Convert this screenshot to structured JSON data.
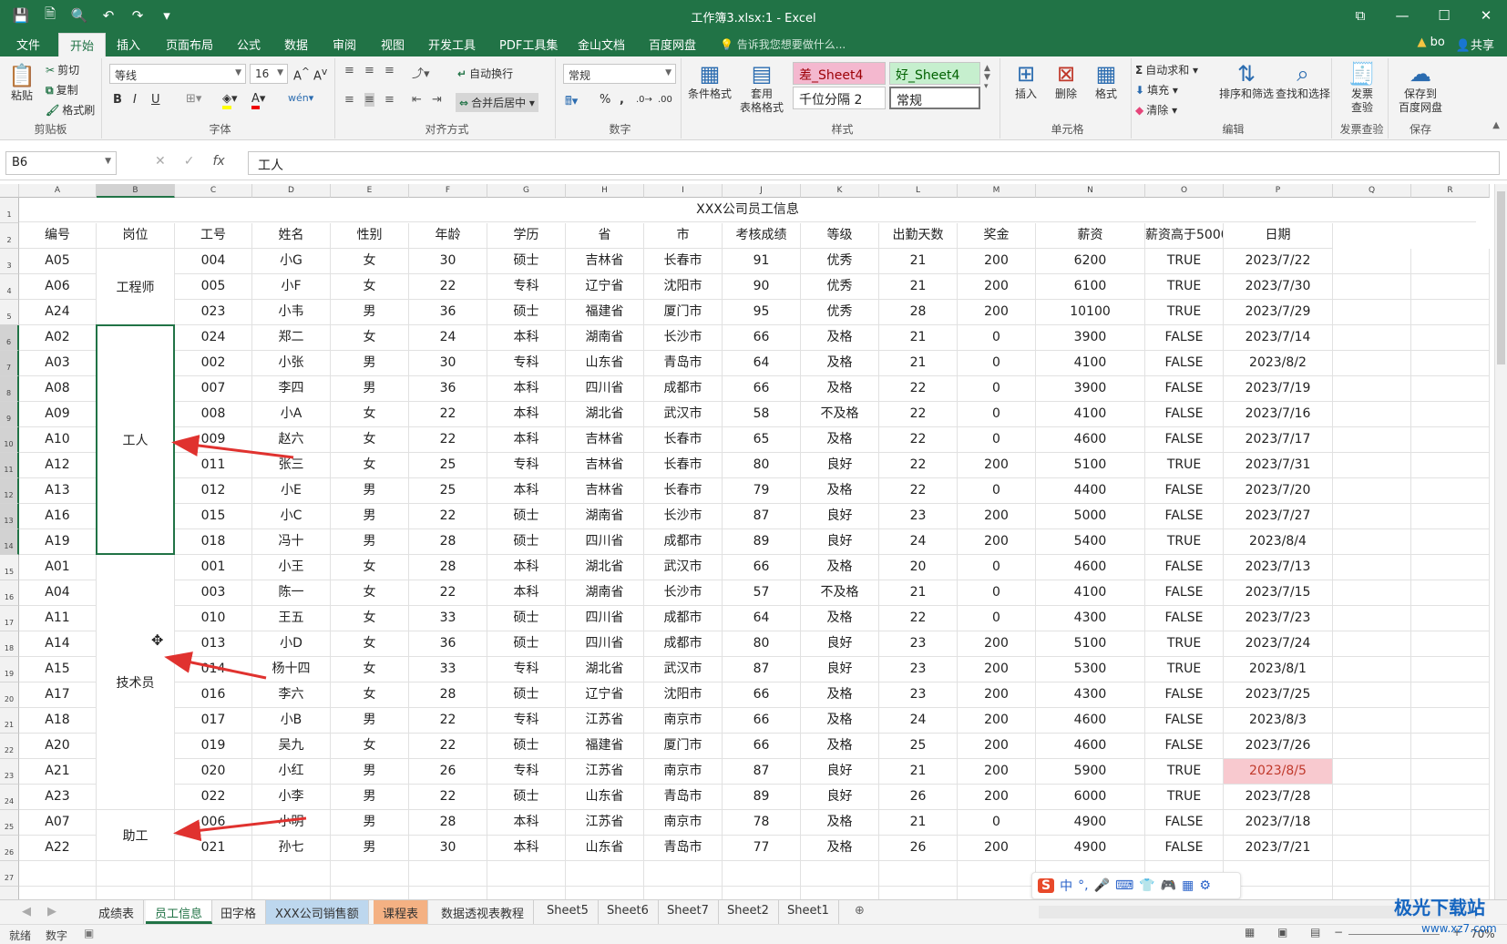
{
  "window": {
    "title": "工作簿3.xlsx:1  -  Excel",
    "ctrl_ribbon": "⧉",
    "ctrl_min": "—",
    "ctrl_max": "☐",
    "ctrl_close": "✕"
  },
  "qat": [
    {
      "name": "save-icon",
      "glyph": "💾"
    },
    {
      "name": "print-preview-icon",
      "glyph": "🗎"
    },
    {
      "name": "find-icon",
      "glyph": "🔍"
    },
    {
      "name": "undo-icon",
      "glyph": "↶"
    },
    {
      "name": "redo-icon",
      "glyph": "↷"
    },
    {
      "name": "customize-icon",
      "glyph": "▾"
    }
  ],
  "ribbon_tabs": [
    "文件",
    "开始",
    "插入",
    "页面布局",
    "公式",
    "数据",
    "审阅",
    "视图",
    "开发工具",
    "PDF工具集",
    "金山文档",
    "百度网盘"
  ],
  "tellme": "告诉我您想要做什么...",
  "account": {
    "warn": "bo",
    "share": "共享"
  },
  "ribbon": {
    "clipboard": {
      "label": "剪贴板",
      "paste": "粘贴",
      "cut": "剪切",
      "copy": "复制",
      "painter": "格式刷"
    },
    "font": {
      "label": "字体",
      "name": "等线",
      "size": "16",
      "bold": "B",
      "italic": "I",
      "underline": "U"
    },
    "align": {
      "label": "对齐方式",
      "wrap": "自动换行",
      "merge": "合并后居中"
    },
    "number": {
      "label": "数字",
      "format": "常规",
      "percent": "%",
      "comma": ","
    },
    "styles": {
      "label": "样式",
      "cond": "条件格式",
      "table": "套用\n表格格式",
      "bad": "差_Sheet4",
      "good": "好_Sheet4",
      "comma2": "千位分隔 2",
      "normal": "常规"
    },
    "cells": {
      "label": "单元格",
      "insert": "插入",
      "delete": "删除",
      "format": "格式"
    },
    "editing": {
      "label": "编辑",
      "autosum": "自动求和",
      "fill": "填充",
      "clear": "清除",
      "sort": "排序和筛选",
      "find": "查找和选择"
    },
    "invoice": {
      "label": "发票查验",
      "btn": "发票\n查验"
    },
    "save": {
      "label": "保存",
      "btn": "保存到\n百度网盘"
    }
  },
  "formula_bar": {
    "cell_ref": "B6",
    "content": "工人"
  },
  "columns": [
    "A",
    "B",
    "C",
    "D",
    "E",
    "F",
    "G",
    "H",
    "I",
    "J",
    "K",
    "L",
    "M",
    "N",
    "O",
    "P",
    "Q",
    "R"
  ],
  "sheet_title": "XXX公司员工信息",
  "headers": [
    "编号",
    "岗位",
    "工号",
    "姓名",
    "性别",
    "年龄",
    "学历",
    "省",
    "市",
    "考核成绩",
    "等级",
    "出勤天数",
    "奖金",
    "薪资",
    "薪资高于5000",
    "日期"
  ],
  "groups": [
    {
      "label": "工程师",
      "from": 3,
      "to": 5
    },
    {
      "label": "工人",
      "from": 6,
      "to": 14
    },
    {
      "label": "技术员",
      "from": 15,
      "to": 24
    },
    {
      "label": "助工",
      "from": 25,
      "to": 26
    }
  ],
  "rows": [
    [
      "A05",
      "",
      "004",
      "小G",
      "女",
      "30",
      "硕士",
      "吉林省",
      "长春市",
      "91",
      "优秀",
      "21",
      "200",
      "6200",
      "TRUE",
      "2023/7/22"
    ],
    [
      "A06",
      "",
      "005",
      "小F",
      "女",
      "22",
      "专科",
      "辽宁省",
      "沈阳市",
      "90",
      "优秀",
      "21",
      "200",
      "6100",
      "TRUE",
      "2023/7/30"
    ],
    [
      "A24",
      "",
      "023",
      "小韦",
      "男",
      "36",
      "硕士",
      "福建省",
      "厦门市",
      "95",
      "优秀",
      "28",
      "200",
      "10100",
      "TRUE",
      "2023/7/29"
    ],
    [
      "A02",
      "",
      "024",
      "郑二",
      "女",
      "24",
      "本科",
      "湖南省",
      "长沙市",
      "66",
      "及格",
      "21",
      "0",
      "3900",
      "FALSE",
      "2023/7/14"
    ],
    [
      "A03",
      "",
      "002",
      "小张",
      "男",
      "30",
      "专科",
      "山东省",
      "青岛市",
      "64",
      "及格",
      "21",
      "0",
      "4100",
      "FALSE",
      "2023/8/2"
    ],
    [
      "A08",
      "",
      "007",
      "李四",
      "男",
      "36",
      "本科",
      "四川省",
      "成都市",
      "66",
      "及格",
      "22",
      "0",
      "3900",
      "FALSE",
      "2023/7/19"
    ],
    [
      "A09",
      "",
      "008",
      "小A",
      "女",
      "22",
      "本科",
      "湖北省",
      "武汉市",
      "58",
      "不及格",
      "22",
      "0",
      "4100",
      "FALSE",
      "2023/7/16"
    ],
    [
      "A10",
      "",
      "009",
      "赵六",
      "女",
      "22",
      "本科",
      "吉林省",
      "长春市",
      "65",
      "及格",
      "22",
      "0",
      "4600",
      "FALSE",
      "2023/7/17"
    ],
    [
      "A12",
      "",
      "011",
      "张三",
      "女",
      "25",
      "专科",
      "吉林省",
      "长春市",
      "80",
      "良好",
      "22",
      "200",
      "5100",
      "TRUE",
      "2023/7/31"
    ],
    [
      "A13",
      "",
      "012",
      "小E",
      "男",
      "25",
      "本科",
      "吉林省",
      "长春市",
      "79",
      "及格",
      "22",
      "0",
      "4400",
      "FALSE",
      "2023/7/20"
    ],
    [
      "A16",
      "",
      "015",
      "小C",
      "男",
      "22",
      "硕士",
      "湖南省",
      "长沙市",
      "87",
      "良好",
      "23",
      "200",
      "5000",
      "FALSE",
      "2023/7/27"
    ],
    [
      "A19",
      "",
      "018",
      "冯十",
      "男",
      "28",
      "硕士",
      "四川省",
      "成都市",
      "89",
      "良好",
      "24",
      "200",
      "5400",
      "TRUE",
      "2023/8/4"
    ],
    [
      "A01",
      "",
      "001",
      "小王",
      "女",
      "28",
      "本科",
      "湖北省",
      "武汉市",
      "66",
      "及格",
      "20",
      "0",
      "4600",
      "FALSE",
      "2023/7/13"
    ],
    [
      "A04",
      "",
      "003",
      "陈一",
      "女",
      "22",
      "本科",
      "湖南省",
      "长沙市",
      "57",
      "不及格",
      "21",
      "0",
      "4100",
      "FALSE",
      "2023/7/15"
    ],
    [
      "A11",
      "",
      "010",
      "王五",
      "女",
      "33",
      "硕士",
      "四川省",
      "成都市",
      "64",
      "及格",
      "22",
      "0",
      "4300",
      "FALSE",
      "2023/7/23"
    ],
    [
      "A14",
      "",
      "013",
      "小D",
      "女",
      "36",
      "硕士",
      "四川省",
      "成都市",
      "80",
      "良好",
      "23",
      "200",
      "5100",
      "TRUE",
      "2023/7/24"
    ],
    [
      "A15",
      "",
      "014",
      "杨十四",
      "女",
      "33",
      "专科",
      "湖北省",
      "武汉市",
      "87",
      "良好",
      "23",
      "200",
      "5300",
      "TRUE",
      "2023/8/1"
    ],
    [
      "A17",
      "",
      "016",
      "李六",
      "女",
      "28",
      "硕士",
      "辽宁省",
      "沈阳市",
      "66",
      "及格",
      "23",
      "200",
      "4300",
      "FALSE",
      "2023/7/25"
    ],
    [
      "A18",
      "",
      "017",
      "小B",
      "男",
      "22",
      "专科",
      "江苏省",
      "南京市",
      "66",
      "及格",
      "24",
      "200",
      "4600",
      "FALSE",
      "2023/8/3"
    ],
    [
      "A20",
      "",
      "019",
      "吴九",
      "女",
      "22",
      "硕士",
      "福建省",
      "厦门市",
      "66",
      "及格",
      "25",
      "200",
      "4600",
      "FALSE",
      "2023/7/26"
    ],
    [
      "A21",
      "",
      "020",
      "小红",
      "男",
      "26",
      "专科",
      "江苏省",
      "南京市",
      "87",
      "良好",
      "21",
      "200",
      "5900",
      "TRUE",
      "2023/8/5"
    ],
    [
      "A23",
      "",
      "022",
      "小李",
      "男",
      "22",
      "硕士",
      "山东省",
      "青岛市",
      "89",
      "良好",
      "26",
      "200",
      "6000",
      "TRUE",
      "2023/7/28"
    ],
    [
      "A07",
      "",
      "006",
      "小明",
      "男",
      "28",
      "本科",
      "江苏省",
      "南京市",
      "78",
      "及格",
      "21",
      "0",
      "4900",
      "FALSE",
      "2023/7/18"
    ],
    [
      "A22",
      "",
      "021",
      "孙七",
      "男",
      "30",
      "本科",
      "山东省",
      "青岛市",
      "77",
      "及格",
      "26",
      "200",
      "4900",
      "FALSE",
      "2023/7/21"
    ]
  ],
  "highlight": {
    "color": "#f8c9cf",
    "text_color": "#c0392b"
  },
  "sheet_tabs": [
    {
      "label": "成绩表",
      "color": ""
    },
    {
      "label": "员工信息",
      "color": "",
      "active": true
    },
    {
      "label": "田字格",
      "color": ""
    },
    {
      "label": "XXX公司销售额",
      "color": "#bdd7ee"
    },
    {
      "label": "课程表",
      "color": "#f4b183"
    },
    {
      "label": "数据透视表教程",
      "color": ""
    },
    {
      "label": "Sheet5",
      "color": ""
    },
    {
      "label": "Sheet6",
      "color": ""
    },
    {
      "label": "Sheet7",
      "color": ""
    },
    {
      "label": "Sheet2",
      "color": ""
    },
    {
      "label": "Sheet1",
      "color": ""
    }
  ],
  "status": {
    "ready": "就绪",
    "numlock": "数字",
    "zoom": "70%"
  },
  "watermark": {
    "logo": "极光下载站",
    "url": "www.xz7.com"
  },
  "ime": {
    "glyph": "S",
    "lang": "中",
    "punct": "°,"
  }
}
